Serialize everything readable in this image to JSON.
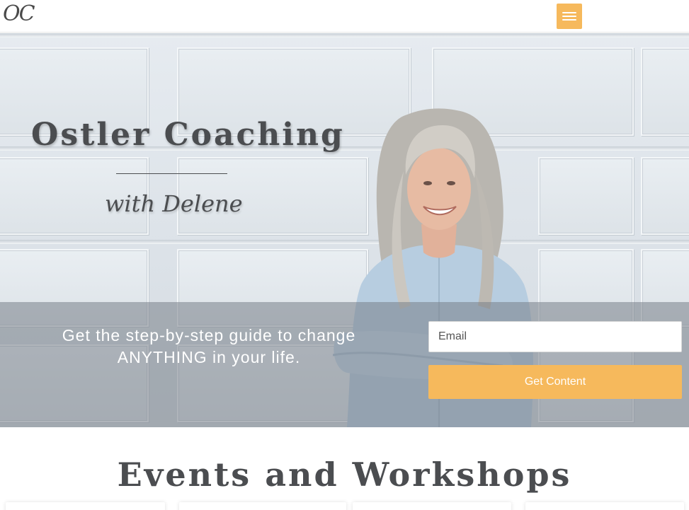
{
  "header": {
    "logo_text": "OC",
    "menu_icon": "hamburger-menu-icon",
    "accent_color": "#f6b95c"
  },
  "hero": {
    "title": "Ostler Coaching",
    "subtitle": "with Delene",
    "tagline": "Get the step-by-step guide to change ANYTHING in your life.",
    "email_placeholder": "Email",
    "cta_label": "Get Content"
  },
  "events": {
    "title": "Events and Workshops"
  }
}
